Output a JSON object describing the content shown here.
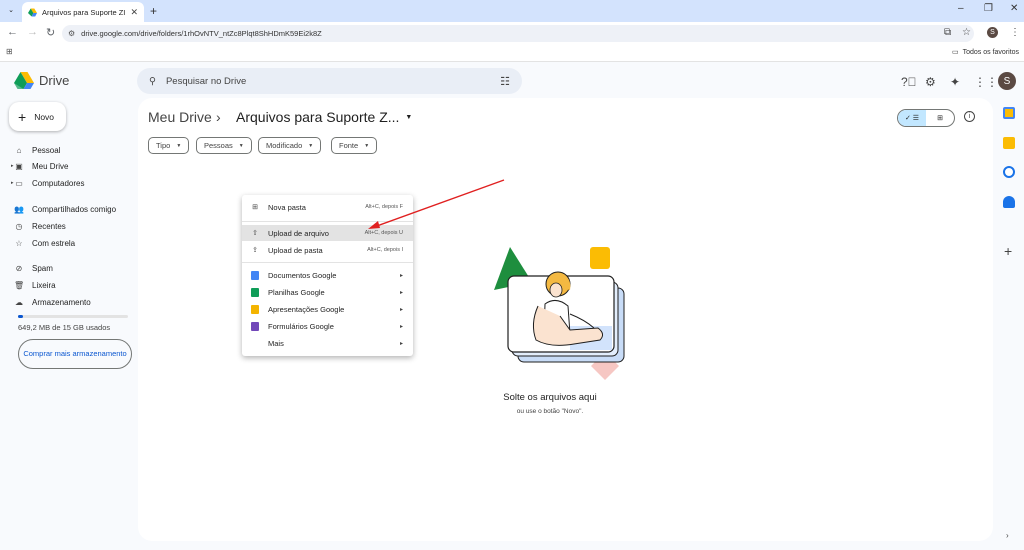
{
  "browser": {
    "tab_title": "Arquivos para Suporte ZIEVO - Goo",
    "tab_close": "✕",
    "new_tab": "+",
    "url": "drive.google.com/drive/folders/1rhOvNTV_ntZc8Plqt8ShHDmK59Ei2k8Z",
    "profile_initial": "S",
    "bookmarks_all": "Todos os favoritos"
  },
  "drive": {
    "app_name": "Drive",
    "search_placeholder": "Pesquisar no Drive",
    "user_initial": "S",
    "new_button": "Novo",
    "sidebar": [
      {
        "label": "Pessoal",
        "icon": "home-icon",
        "glyph": "⌂"
      },
      {
        "label": "Meu Drive",
        "icon": "drive-icon",
        "glyph": "▣"
      },
      {
        "label": "Computadores",
        "icon": "computer-icon",
        "glyph": "▭"
      },
      {
        "label": "Compartilhados comigo",
        "icon": "people-icon",
        "glyph": "👥"
      },
      {
        "label": "Recentes",
        "icon": "clock-icon",
        "glyph": "◷"
      },
      {
        "label": "Com estrela",
        "icon": "star-icon",
        "glyph": "☆"
      },
      {
        "label": "Spam",
        "icon": "spam-icon",
        "glyph": "⊘"
      },
      {
        "label": "Lixeira",
        "icon": "trash-icon",
        "glyph": "🗑"
      },
      {
        "label": "Armazenamento",
        "icon": "cloud-icon",
        "glyph": "☁"
      }
    ],
    "storage_used_fraction": 0.043,
    "storage_text": "649,2 MB de 15 GB usados",
    "buy_storage": "Comprar mais armazenamento",
    "breadcrumb_root": "Meu Drive",
    "breadcrumb_sep": "›",
    "breadcrumb_current": "Arquivos para Suporte Z...",
    "filters": [
      "Tipo",
      "Pessoas",
      "Modificado",
      "Fonte"
    ],
    "menu": {
      "new_folder": {
        "label": "Nova pasta",
        "shortcut": "Alt+C, depois F"
      },
      "upload_file": {
        "label": "Upload de arquivo",
        "shortcut": "Alt+C, depois U"
      },
      "upload_folder": {
        "label": "Upload de pasta",
        "shortcut": "Alt+C, depois I"
      },
      "docs": {
        "label": "Documentos Google"
      },
      "sheets": {
        "label": "Planilhas Google"
      },
      "slides": {
        "label": "Apresentações Google"
      },
      "forms": {
        "label": "Formulários Google"
      },
      "more": {
        "label": "Mais"
      }
    },
    "empty_title": "Solte os arquivos aqui",
    "empty_sub": "ou use o botão \"Novo\"."
  },
  "colors": {
    "docs": "#4285f4",
    "sheets": "#0f9d58",
    "slides": "#f4b400",
    "forms": "#7248b9",
    "accent": "#0b57d0",
    "arrow": "#e02020"
  }
}
